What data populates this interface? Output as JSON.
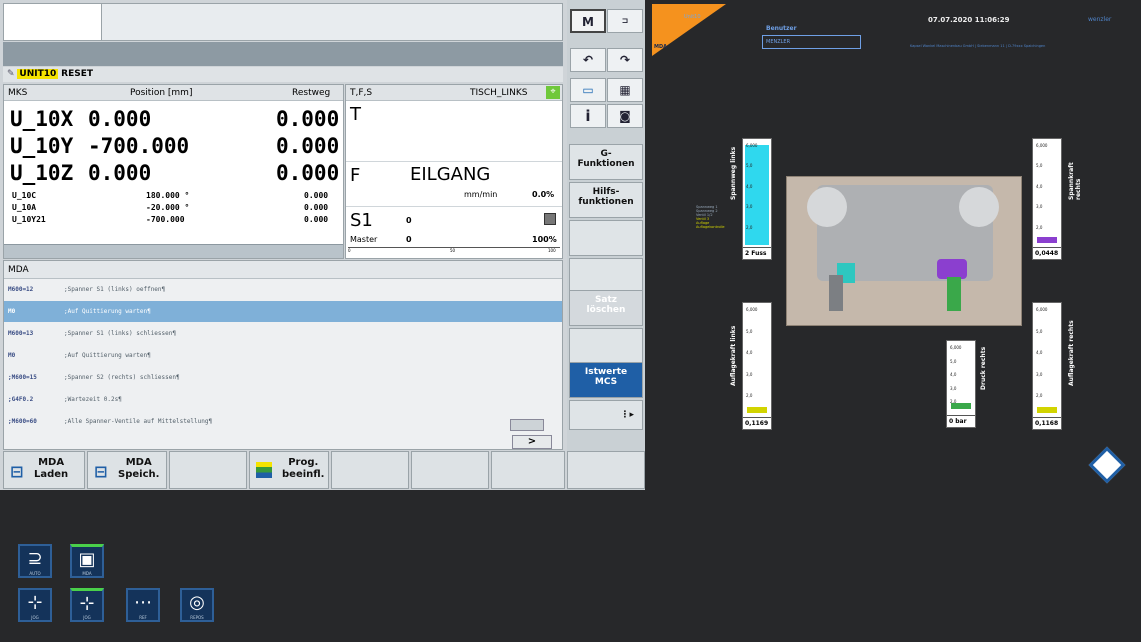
{
  "status": {
    "unit": "UNIT10",
    "reset": "RESET"
  },
  "mks": {
    "headers": {
      "mks": "MKS",
      "position": "Position [mm]",
      "restweg": "Restweg"
    },
    "big_axes": [
      {
        "name": "U_10X",
        "pos": "0.000",
        "rest": "0.000"
      },
      {
        "name": "U_10Y",
        "pos": "-700.000",
        "rest": "0.000"
      },
      {
        "name": "U_10Z",
        "pos": "0.000",
        "rest": "0.000"
      }
    ],
    "small_axes": [
      {
        "name": "U_10C",
        "pos": "180.000 °",
        "rest": "0.000"
      },
      {
        "name": "U_10A",
        "pos": "-20.000 °",
        "rest": "0.000"
      },
      {
        "name": "U_10Y21",
        "pos": "-700.000",
        "rest": "0.000"
      }
    ]
  },
  "tfs": {
    "header": "T,F,S",
    "table": "TISCH_LINKS",
    "t_label": "T",
    "f_label": "F",
    "f_value": "EILGANG",
    "f_unit": "mm/min",
    "f_pct": "0.0%",
    "s_label": "S1",
    "s_value": "0",
    "master_label": "Master",
    "master_value": "0",
    "master_pct": "100%",
    "scale": [
      "0",
      "50",
      "100"
    ]
  },
  "mda": {
    "title": "MDA",
    "lines": [
      {
        "n": "M600=12",
        "c": ";Spanner S1 (links) oeffnen¶"
      },
      {
        "n": "M0",
        "c": ";Auf Quittierung warten¶"
      },
      {
        "n": "M600=13",
        "c": ";Spanner S1 (links) schliessen¶"
      },
      {
        "n": "M0",
        "c": ";Auf Quittierung warten¶"
      },
      {
        "n": ";M600=15",
        "c": ";Spanner S2 (rechts) schliessen¶"
      },
      {
        "n": ";G4F0.2",
        "c": ";Wartezeit 0.2s¶"
      },
      {
        "n": ";M600=60",
        "c": ";Alle Spanner-Ventile auf Mittelstellung¶"
      }
    ],
    "arrow": ">"
  },
  "vsoft": {
    "m_label": "M",
    "g_funk": "G-\nFunktionen",
    "hilfs_funk": "Hilfs-\nfunktionen",
    "satz_loeschen": "Satz\nlöschen",
    "istwerte": "Istwerte\nMCS"
  },
  "hsoft": {
    "mda_laden": "MDA\nLaden",
    "mda_speich": "MDA\nSpeich.",
    "prog_beeinfl": "Prog.\nbeeinfl."
  },
  "right": {
    "mode": "MDA",
    "unit_tag": "Unit10",
    "user_label": "Benutzer",
    "user_value": "MENZLER",
    "datetime": "07.07.2020 11:06:29",
    "company": "Kapsel Wankel Maschinenbau GmbH | Siebenmann 11 | D-79xxx Spaichingen",
    "brand": "wenzler",
    "gauges": {
      "spannweg_links": {
        "label": "Spannweg links",
        "value": "2 Fuss"
      },
      "spannkraft_rechts": {
        "label": "Spannkraft rechts",
        "value": "0,0448"
      },
      "auflagekraft_links": {
        "label": "Auflagekraft links",
        "value": "0,1169"
      },
      "druck_rechts": {
        "label": "Druck rechts",
        "value": "0 bar"
      },
      "auflagekraft_rechts": {
        "label": "Auflagekraft rechts",
        "value": "0,1168"
      }
    },
    "scale_vals": [
      "6,000",
      "5,0",
      "4,0",
      "3,0",
      "2,0"
    ],
    "legend_lines": [
      "Spannweg 1",
      "Spannweg 2",
      "Ventil 1/2",
      "Ventil 3",
      "Auflage",
      "Auflagekontrolle"
    ]
  },
  "keys": {
    "k1": "AUTO",
    "k2": "MDA",
    "k3": "JOG",
    "k4": "JOG",
    "k5": "REF",
    "k6": "REPOS"
  },
  "colors": {
    "accent_orange": "#f5921e",
    "cyan_fill": "#2fd8ee",
    "selection": "#7fb0d8"
  }
}
